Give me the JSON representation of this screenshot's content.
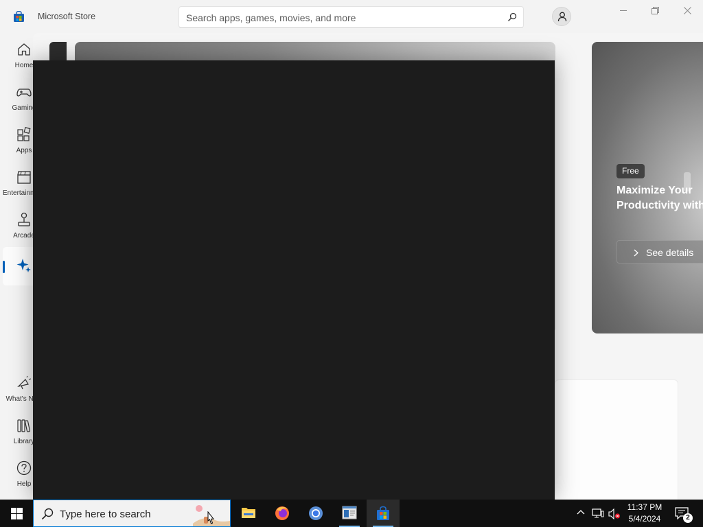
{
  "titlebar": {
    "app_title": "Microsoft Store",
    "app_icon": "store-icon",
    "search_placeholder": "Search apps, games, movies, and more",
    "account_icon": "person-icon",
    "window_controls": [
      "minimize-icon",
      "restore-icon",
      "close-icon"
    ]
  },
  "sidebar": {
    "items": [
      {
        "label": "Home",
        "icon": "home-icon",
        "active": false
      },
      {
        "label": "Gaming",
        "icon": "gamepad-icon",
        "active": false
      },
      {
        "label": "Apps",
        "icon": "apps-grid-icon",
        "active": false
      },
      {
        "label": "Entertainment",
        "icon": "clapperboard-icon",
        "active": false
      },
      {
        "label": "Arcade",
        "icon": "joystick-icon",
        "active": false
      },
      {
        "label": "",
        "icon": "sparkle-icon",
        "active": true
      }
    ],
    "bottom_items": [
      {
        "label": "What's New",
        "icon": "megaphone-icon"
      },
      {
        "label": "Library",
        "icon": "library-icon"
      },
      {
        "label": "Help",
        "icon": "help-icon"
      }
    ]
  },
  "promo": {
    "badge": "Free",
    "title_line1": "Maximize Your",
    "title_line2": "Productivity with",
    "button_label": "See details"
  },
  "taskbar": {
    "search_placeholder": "Type here to search",
    "apps": [
      {
        "name": "File Explorer",
        "icon": "folder-icon",
        "active": false
      },
      {
        "name": "Firefox",
        "icon": "firefox-icon",
        "active": false
      },
      {
        "name": "Chrome",
        "icon": "chrome-icon",
        "active": false
      },
      {
        "name": "App",
        "icon": "window-app-icon",
        "active": true
      },
      {
        "name": "Microsoft Store",
        "icon": "store-icon",
        "active": true
      }
    ],
    "time": "11:37 PM",
    "date": "5/4/2024",
    "notification_count": "2"
  },
  "colors": {
    "accent": "#005fb8",
    "taskbar": "#101010",
    "overlay": "#1c1c1c"
  }
}
